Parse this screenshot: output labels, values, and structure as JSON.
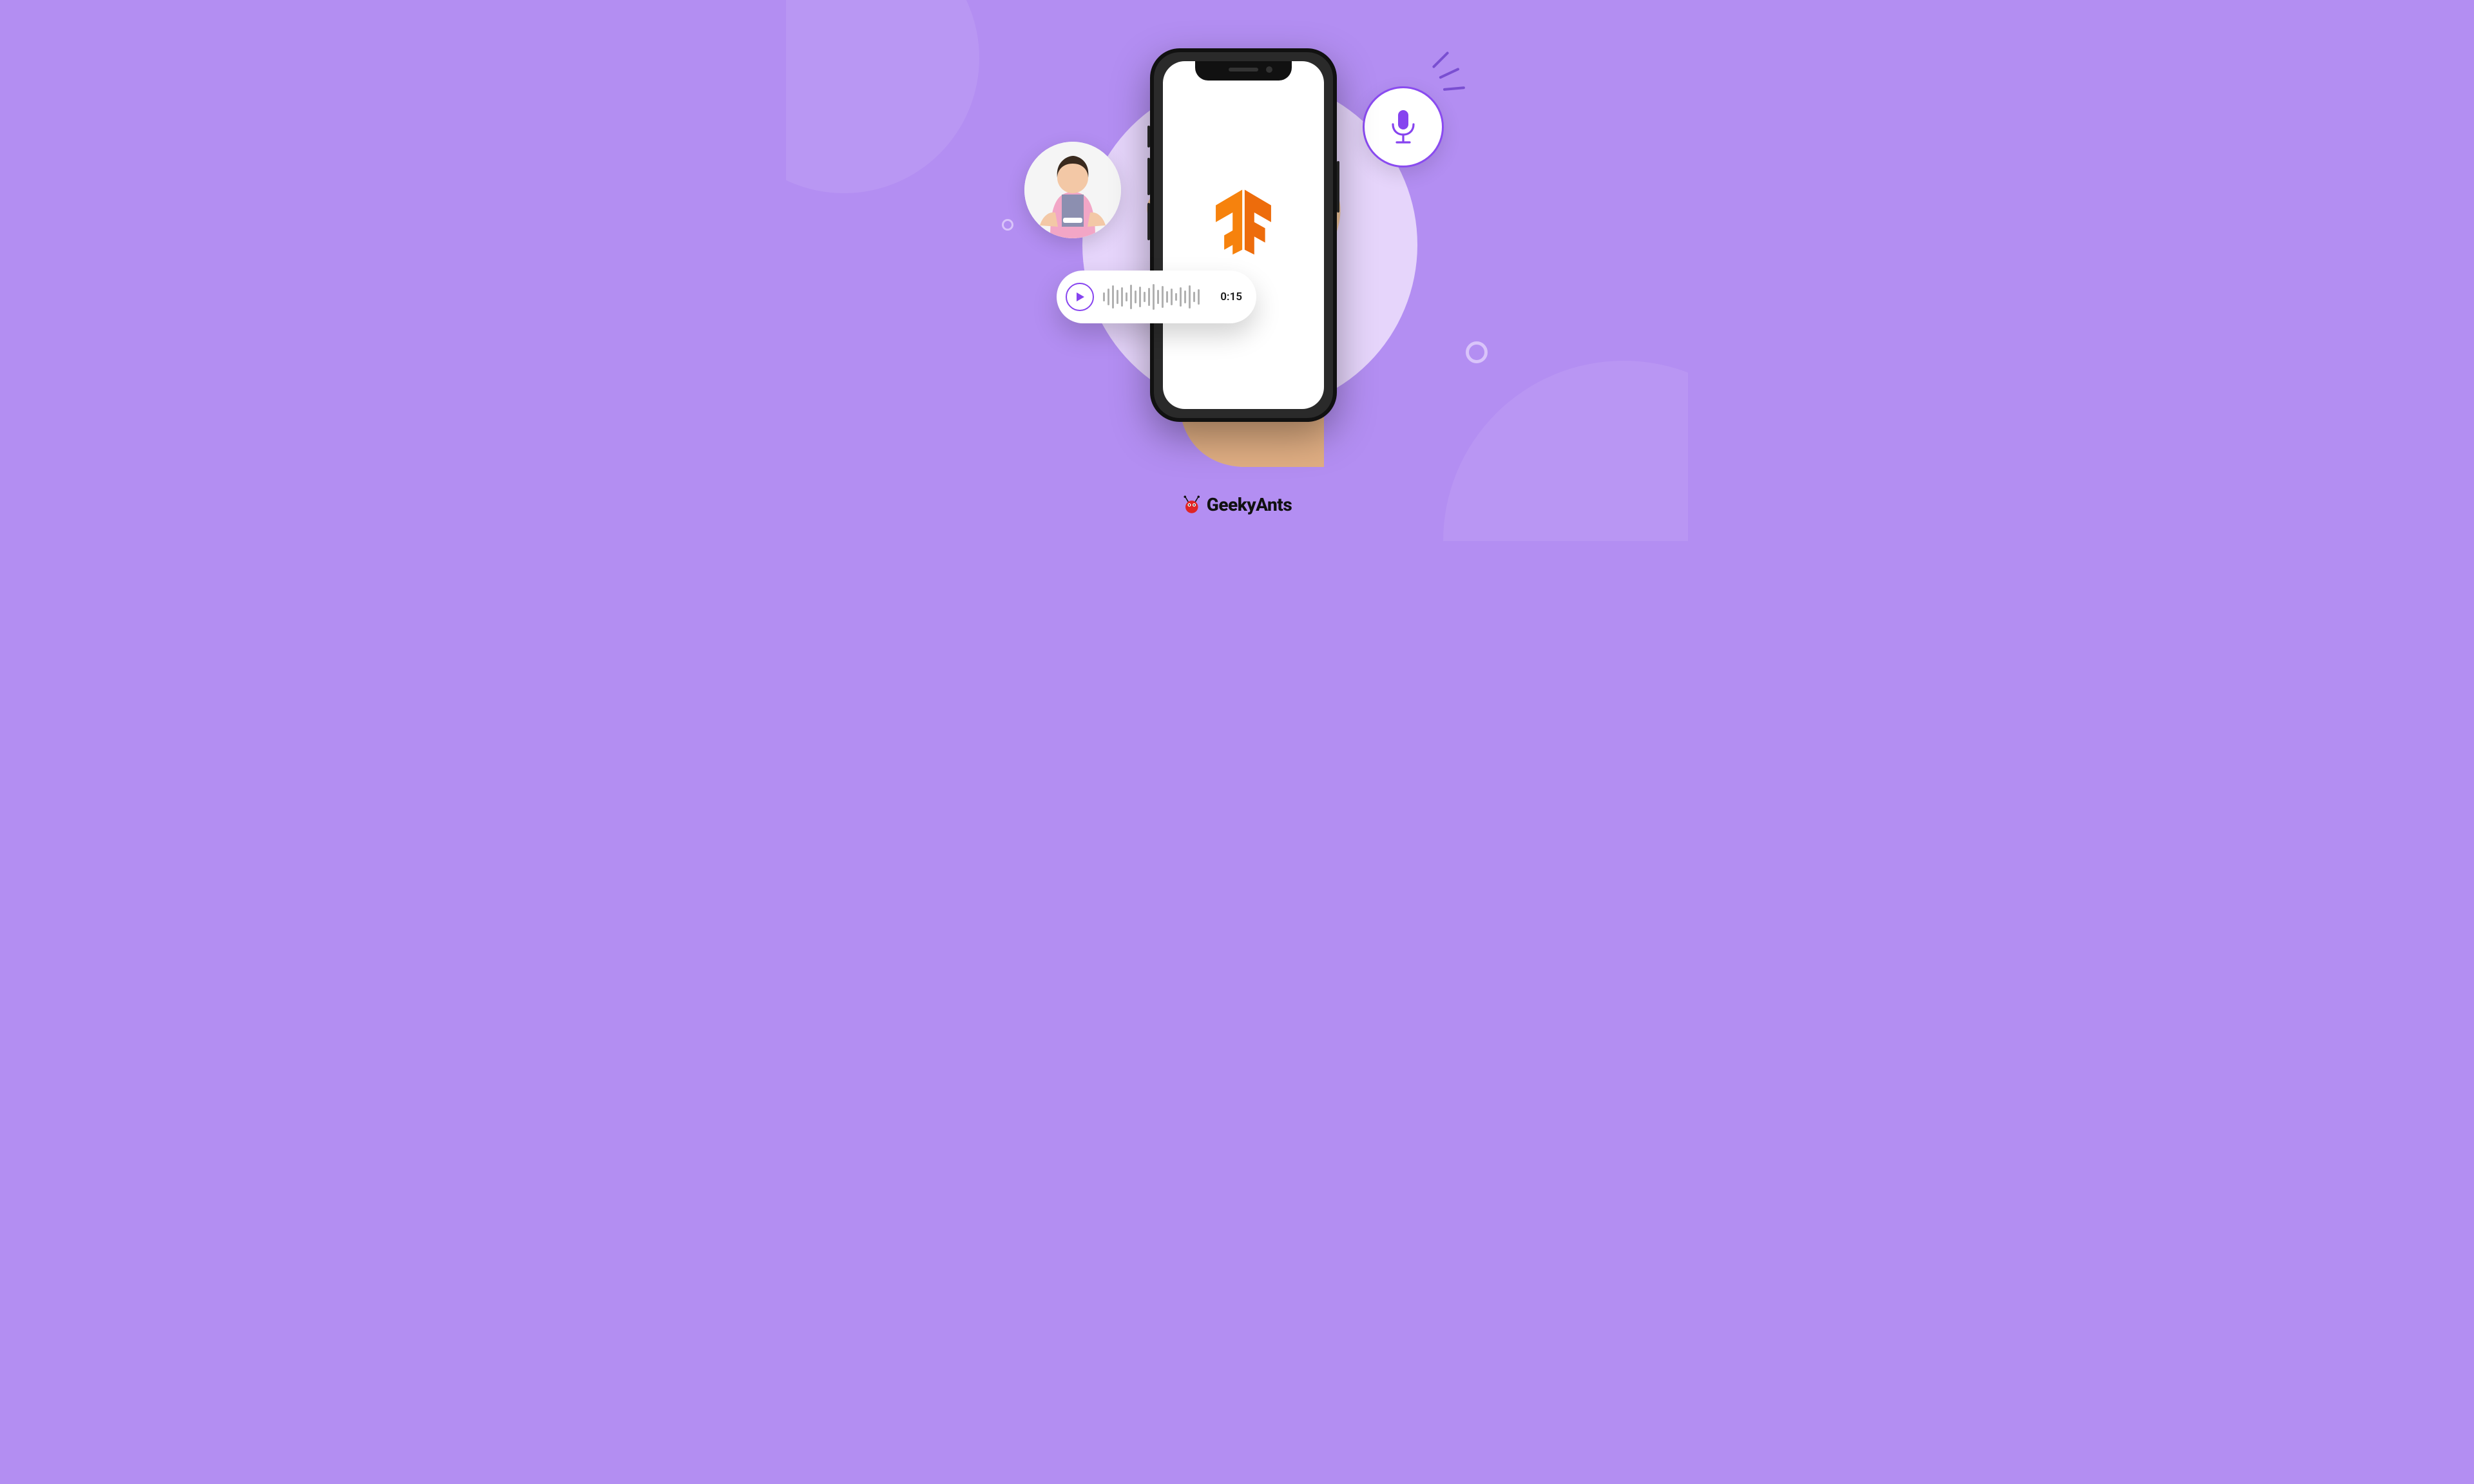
{
  "brand": {
    "name": "GeekyAnts"
  },
  "player": {
    "time": "0:15"
  },
  "icons": {
    "mic": "microphone-icon",
    "play": "play-icon",
    "tensorflow": "tensorflow-logo"
  },
  "colors": {
    "bg": "#b38ef2",
    "accent": "#8643ef",
    "tf_orange": "#f6820d",
    "brand_red": "#e02424"
  }
}
